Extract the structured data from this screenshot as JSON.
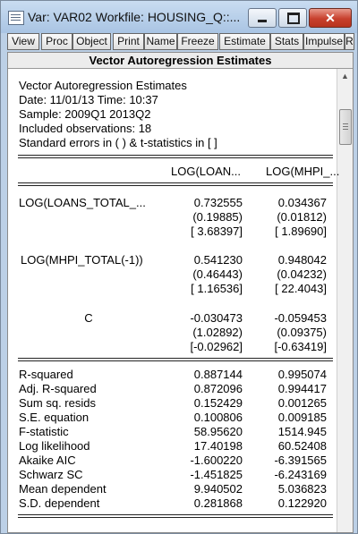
{
  "window": {
    "title": "Var: VAR02   Workfile: HOUSING_Q::..."
  },
  "controls": {
    "close_glyph": "✕"
  },
  "toolbar": [
    "View",
    "Proc",
    "Object",
    "Print",
    "Name",
    "Freeze",
    "Estimate",
    "Stats",
    "Impulse",
    "R"
  ],
  "header": {
    "title": "Vector Autoregression Estimates"
  },
  "info": [
    "Vector Autoregression Estimates",
    "Date: 11/01/13   Time: 10:37",
    "Sample: 2009Q1 2013Q2",
    "Included observations: 18",
    "Standard errors in ( ) & t-statistics in [ ]"
  ],
  "columns": [
    "LOG(LOAN...",
    "LOG(MHPI_..."
  ],
  "coefficients": [
    {
      "label": "LOG(LOANS_TOTAL_...",
      "coef": [
        "0.732555",
        "0.034367"
      ],
      "se": [
        "(0.19885)",
        "(0.01812)"
      ],
      "t": [
        "[ 3.68397]",
        "[ 1.89690]"
      ]
    },
    {
      "label": "LOG(MHPI_TOTAL(-1))",
      "coef": [
        "0.541230",
        "0.948042"
      ],
      "se": [
        "(0.46443)",
        "(0.04232)"
      ],
      "t": [
        "[ 1.16536]",
        "[ 22.4043]"
      ]
    },
    {
      "label": "C",
      "coef": [
        "-0.030473",
        "-0.059453"
      ],
      "se": [
        "(1.02892)",
        "(0.09375)"
      ],
      "t": [
        "[-0.02962]",
        "[-0.63419]"
      ]
    }
  ],
  "stats": [
    {
      "label": "R-squared",
      "v1": "0.887144",
      "v2": "0.995074"
    },
    {
      "label": "Adj. R-squared",
      "v1": "0.872096",
      "v2": "0.994417"
    },
    {
      "label": "Sum sq. resids",
      "v1": "0.152429",
      "v2": "0.001265"
    },
    {
      "label": "S.E. equation",
      "v1": "0.100806",
      "v2": "0.009185"
    },
    {
      "label": "F-statistic",
      "v1": "58.95620",
      "v2": "1514.945"
    },
    {
      "label": "Log likelihood",
      "v1": "17.40198",
      "v2": "60.52408"
    },
    {
      "label": "Akaike AIC",
      "v1": "-1.600220",
      "v2": "-6.391565"
    },
    {
      "label": "Schwarz SC",
      "v1": "-1.451825",
      "v2": "-6.243169"
    },
    {
      "label": "Mean dependent",
      "v1": "9.940502",
      "v2": "5.036823"
    },
    {
      "label": "S.D. dependent",
      "v1": "0.281868",
      "v2": "0.122920"
    }
  ]
}
